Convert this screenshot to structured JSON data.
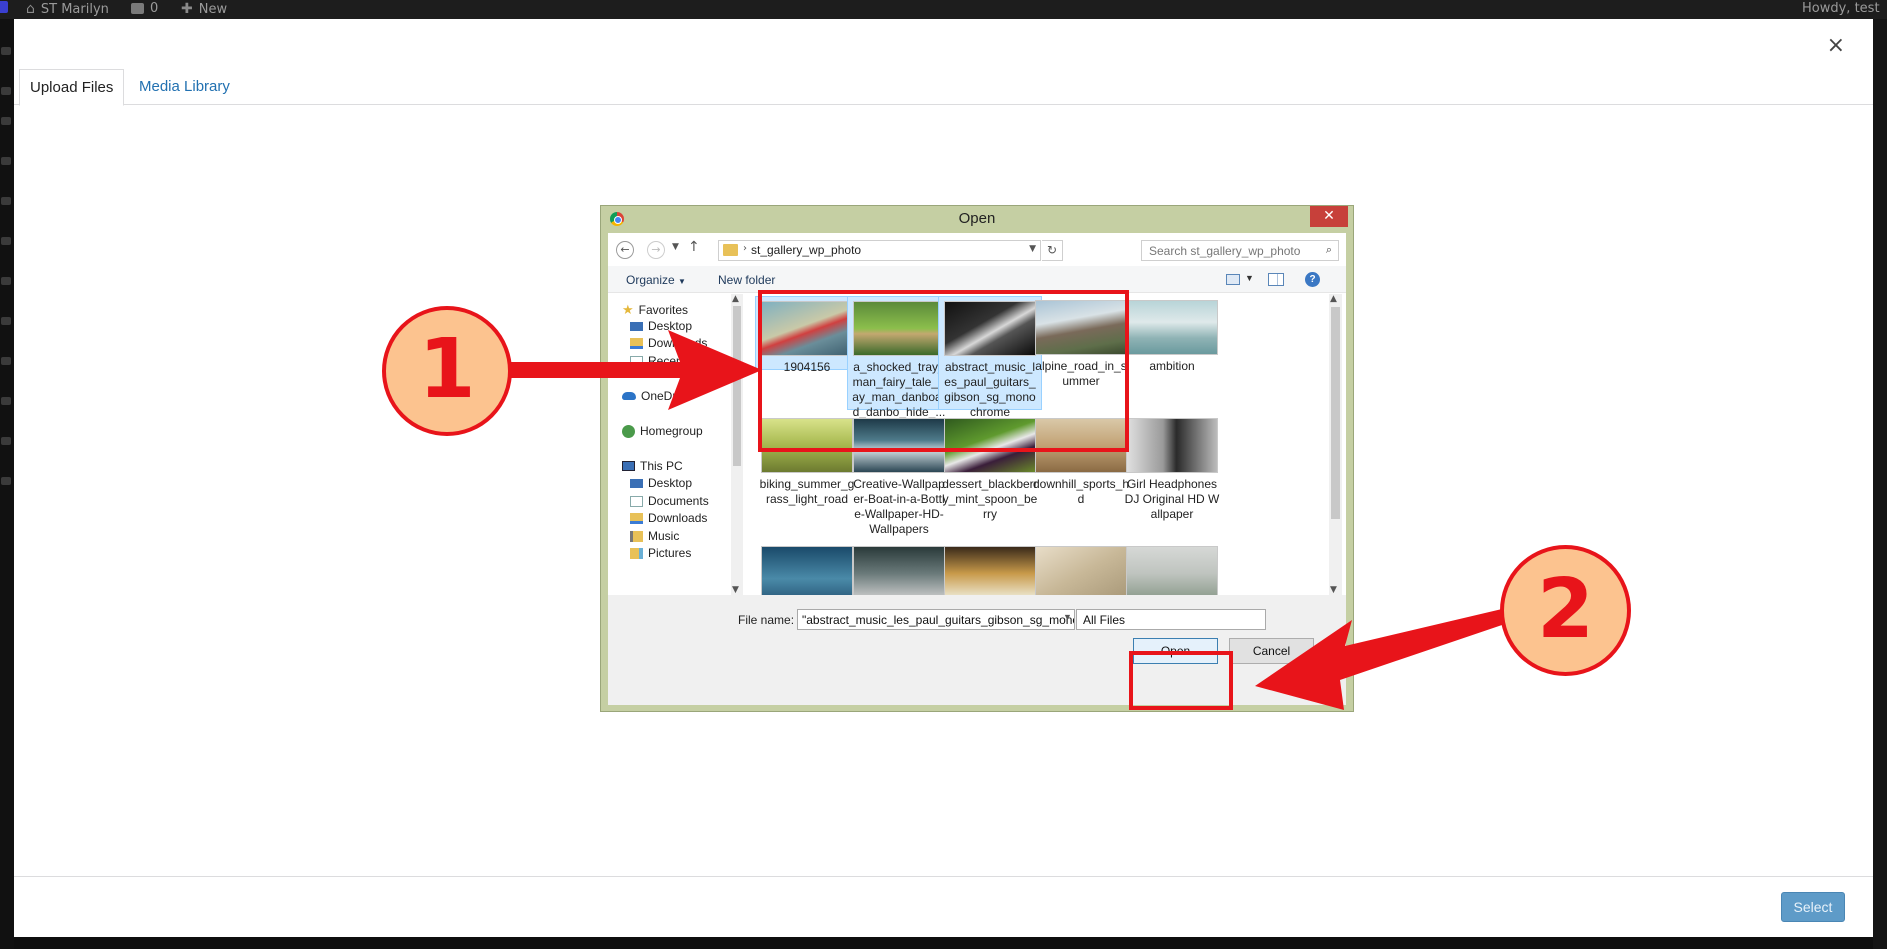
{
  "admin_bar": {
    "site_name": "ST Marilyn",
    "comments_count": "0",
    "new_label": "New",
    "howdy": "Howdy, test"
  },
  "modal": {
    "close_glyph": "×",
    "tabs": [
      {
        "label": "Upload Files",
        "active": true
      },
      {
        "label": "Media Library",
        "active": false
      }
    ],
    "select_button": "Select"
  },
  "dialog": {
    "title": "Open",
    "close_glyph": "✕",
    "address_path": "st_gallery_wp_photo",
    "search_placeholder": "Search st_gallery_wp_photo",
    "toolbar": {
      "organize": "Organize",
      "new_folder": "New folder"
    },
    "nav": {
      "favorites": "Favorites",
      "favorites_items": [
        "Desktop",
        "Downloads",
        "Recent places"
      ],
      "onedrive": "OneDrive",
      "homegroup": "Homegroup",
      "this_pc": "This PC",
      "pc_items": [
        "Desktop",
        "Documents",
        "Downloads",
        "Music",
        "Pictures"
      ]
    },
    "files": [
      {
        "name": "1904156",
        "selected": true
      },
      {
        "name": "a_shocked_tray_man_fairy_tale_tray_man_danboard_danbo_hide_...",
        "selected": true
      },
      {
        "name": "abstract_music_les_paul_guitars_gibson_sg_monochrome",
        "selected": true
      },
      {
        "name": "alpine_road_in_summer",
        "selected": false
      },
      {
        "name": "ambition",
        "selected": false
      },
      {
        "name": "biking_summer_grass_light_road",
        "selected": false
      },
      {
        "name": "Creative-Wallpaper-Boat-in-a-Bottle-Wallpaper-HD-Wallpapers",
        "selected": false
      },
      {
        "name": "dessert_blackberry_mint_spoon_berry",
        "selected": false
      },
      {
        "name": "downhill_sports_hd",
        "selected": false
      },
      {
        "name": "Girl Headphones DJ Original HD Wallpaper",
        "selected": false
      },
      {
        "name": "",
        "selected": false
      },
      {
        "name": "",
        "selected": false
      },
      {
        "name": "",
        "selected": false
      },
      {
        "name": "",
        "selected": false
      },
      {
        "name": "",
        "selected": false
      }
    ],
    "file_name_label": "File name:",
    "file_name_value": "\"abstract_music_les_paul_guitars_gibson_sg_monochrome",
    "file_type_value": "All Files",
    "open_button": "Open",
    "cancel_button": "Cancel"
  },
  "annotations": {
    "step1": "1",
    "step2": "2",
    "color": "#e8141a",
    "circle_fill": "#fcc38f"
  },
  "colors": {
    "selection_bg": "#cde8ff",
    "link": "#2271b1",
    "dialog_frame": "#c5cfa3"
  }
}
